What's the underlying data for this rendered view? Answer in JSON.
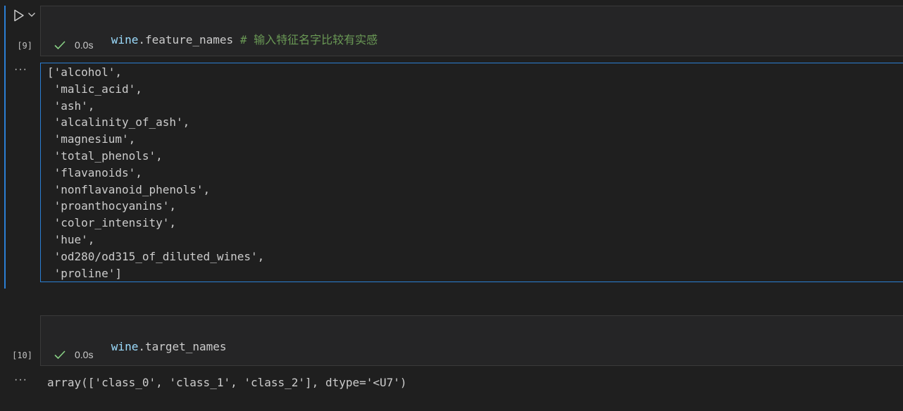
{
  "cells": [
    {
      "execution_count": "[9]",
      "code": {
        "var": "wine",
        "rest": ".feature_names ",
        "comment": "# 输入特征名字比较有实感"
      },
      "status": {
        "icon": "check-icon",
        "time": "0.0s"
      },
      "output_menu": "···",
      "output_lines": [
        "['alcohol',",
        " 'malic_acid',",
        " 'ash',",
        " 'alcalinity_of_ash',",
        " 'magnesium',",
        " 'total_phenols',",
        " 'flavanoids',",
        " 'nonflavanoid_phenols',",
        " 'proanthocyanins',",
        " 'color_intensity',",
        " 'hue',",
        " 'od280/od315_of_diluted_wines',",
        " 'proline']"
      ]
    },
    {
      "execution_count": "[10]",
      "code": {
        "var": "wine",
        "rest": ".target_names",
        "comment": ""
      },
      "status": {
        "icon": "check-icon",
        "time": "0.0s"
      },
      "output_menu": "···",
      "output_lines": [
        "array(['class_0', 'class_1', 'class_2'], dtype='<U7')"
      ]
    }
  ],
  "colors": {
    "background": "#1f1f1f",
    "cell_background": "#252526",
    "focus": "#2b7fd4",
    "variable": "#9cdcfe",
    "comment": "#6a9955",
    "success": "#89d185"
  }
}
